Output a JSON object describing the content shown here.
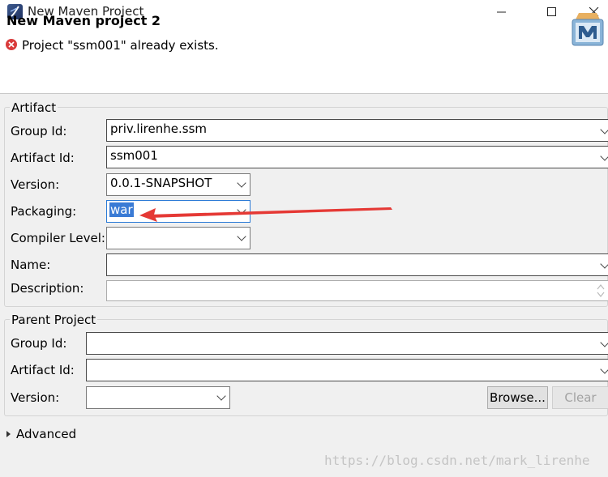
{
  "window": {
    "title": "New Maven Project",
    "app_icon": "eclipse-icon"
  },
  "header": {
    "title": "New Maven project 2",
    "error_message": "Project \"ssm001\" already exists.",
    "wizard_icon": "maven-icon"
  },
  "artifact": {
    "legend": "Artifact",
    "group_id": {
      "label": "Group Id:",
      "value": "priv.lirenhe.ssm"
    },
    "artifact_id": {
      "label": "Artifact Id:",
      "value": "ssm001"
    },
    "version": {
      "label": "Version:",
      "value": "0.0.1-SNAPSHOT"
    },
    "packaging": {
      "label": "Packaging:",
      "value": "war"
    },
    "compiler_level": {
      "label": "Compiler Level:",
      "value": ""
    },
    "name": {
      "label": "Name:",
      "value": ""
    },
    "description": {
      "label": "Description:",
      "value": ""
    }
  },
  "parent": {
    "legend": "Parent Project",
    "group_id": {
      "label": "Group Id:",
      "value": ""
    },
    "artifact_id": {
      "label": "Artifact Id:",
      "value": ""
    },
    "version": {
      "label": "Version:",
      "value": ""
    },
    "browse_label": "Browse...",
    "clear_label": "Clear"
  },
  "advanced": {
    "label": "Advanced"
  },
  "watermark": "https://blog.csdn.net/mark_lirenhe",
  "colors": {
    "error": "#d93c3c",
    "selection": "#3a7bd5",
    "annotation_arrow": "#e53935"
  }
}
